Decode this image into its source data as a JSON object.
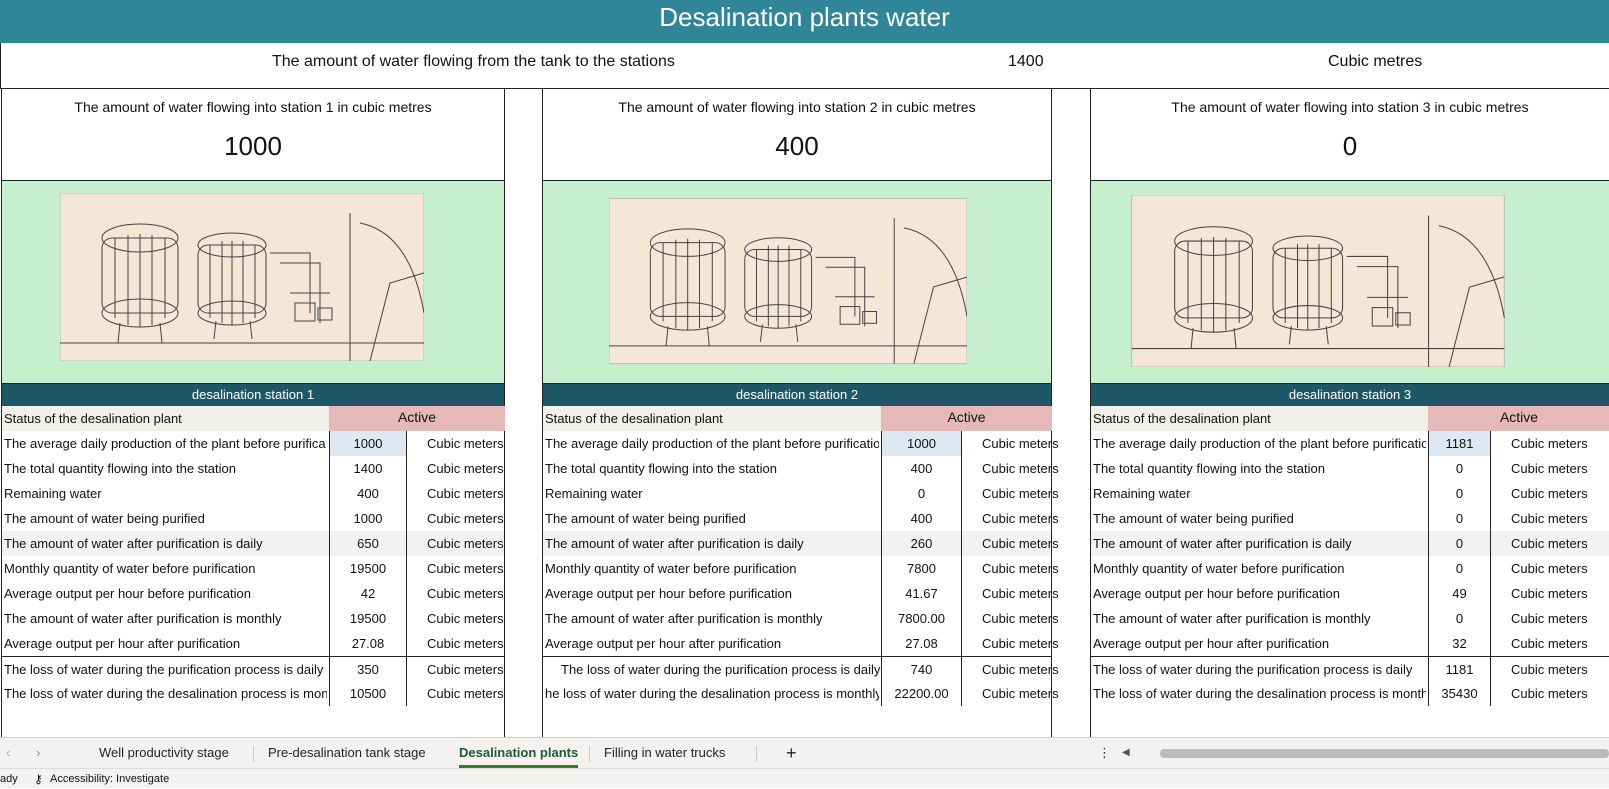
{
  "title": "Desalination plants water",
  "flow": {
    "label": "The amount of water flowing from the tank to the stations",
    "value": "1400",
    "unit": "Cubic metres"
  },
  "stations": [
    {
      "inflow_title": "The amount of water flowing into station 1 in cubic metres",
      "inflow_value": "1000",
      "name": "desalination station 1",
      "status_label": "Status of the desalination plant",
      "status": "Active",
      "rows": [
        {
          "label": "The average daily production of the plant before purifica",
          "value": "1000",
          "unit": "Cubic meters"
        },
        {
          "label": "The total quantity flowing into the station",
          "value": "1400",
          "unit": "Cubic meters"
        },
        {
          "label": "Remaining water",
          "value": "400",
          "unit": "Cubic meters"
        },
        {
          "label": "The amount of water being purified",
          "value": "1000",
          "unit": "Cubic meters"
        },
        {
          "label": "The amount of water after purification is daily",
          "value": "650",
          "unit": "Cubic meters"
        },
        {
          "label": "Monthly quantity of water before purification",
          "value": "19500",
          "unit": "Cubic meters"
        },
        {
          "label": "Average output per hour before purification",
          "value": "42",
          "unit": "Cubic meters"
        },
        {
          "label": "The amount of water after purification is monthly",
          "value": "19500",
          "unit": "Cubic meters"
        },
        {
          "label": "Average output per hour after purification",
          "value": "27.08",
          "unit": "Cubic meters"
        },
        {
          "label": "The loss of water during the purification process is daily",
          "value": "350",
          "unit": "Cubic meters"
        },
        {
          "label": "The loss of water during the desalination process is mont",
          "value": "10500",
          "unit": "Cubic meters"
        }
      ]
    },
    {
      "inflow_title": "The amount of water flowing into station 2 in cubic metres",
      "inflow_value": "400",
      "name": "desalination station 2",
      "status_label": "Status of the desalination plant",
      "status": "Active",
      "rows": [
        {
          "label": "The average daily production of the plant before purificatio",
          "value": "1000",
          "unit": "Cubic meters"
        },
        {
          "label": "The total quantity flowing into the station",
          "value": "400",
          "unit": "Cubic meters"
        },
        {
          "label": "Remaining water",
          "value": "0",
          "unit": "Cubic meters"
        },
        {
          "label": "The amount of water being purified",
          "value": "400",
          "unit": "Cubic meters"
        },
        {
          "label": "The amount of water after purification is daily",
          "value": "260",
          "unit": "Cubic meters"
        },
        {
          "label": "Monthly quantity of water before purification",
          "value": "7800",
          "unit": "Cubic meters"
        },
        {
          "label": "Average output per hour before purification",
          "value": "41.67",
          "unit": "Cubic meters"
        },
        {
          "label": "The amount of water after purification is monthly",
          "value": "7800.00",
          "unit": "Cubic meters"
        },
        {
          "label": "Average output per hour after purification",
          "value": "27.08",
          "unit": "Cubic meters"
        },
        {
          "label": "The loss of water during the purification process is daily",
          "value": "740",
          "unit": "Cubic meters"
        },
        {
          "label": "he loss of water during the desalination process is monthly",
          "value": "22200.00",
          "unit": "Cubic meters"
        }
      ]
    },
    {
      "inflow_title": "The amount of water flowing into station 3 in cubic metres",
      "inflow_value": "0",
      "name": "desalination station 3",
      "status_label": "Status of the desalination plant",
      "status": "Active",
      "rows": [
        {
          "label": "The average daily production of the plant before purificatio",
          "value": "1181",
          "unit": "Cubic meters"
        },
        {
          "label": "The total quantity flowing into the station",
          "value": "0",
          "unit": "Cubic meters"
        },
        {
          "label": "Remaining water",
          "value": "0",
          "unit": "Cubic meters"
        },
        {
          "label": "The amount of water being purified",
          "value": "0",
          "unit": "Cubic meters"
        },
        {
          "label": "The amount of water after purification is daily",
          "value": "0",
          "unit": "Cubic meters"
        },
        {
          "label": "Monthly quantity of water before purification",
          "value": "0",
          "unit": "Cubic meters"
        },
        {
          "label": "Average output per hour before purification",
          "value": "49",
          "unit": "Cubic meters"
        },
        {
          "label": "The amount of water after purification is monthly",
          "value": "0",
          "unit": "Cubic meters"
        },
        {
          "label": "Average output per hour after purification",
          "value": "32",
          "unit": "Cubic meters"
        },
        {
          "label": "The loss of water during the purification process is daily",
          "value": "1181",
          "unit": "Cubic meters"
        },
        {
          "label": "The loss of water during the desalination process is monthl",
          "value": "35430",
          "unit": "Cubic meters"
        }
      ]
    }
  ],
  "sheet_tabs": [
    "Well productivity stage",
    "Pre-desalination tank stage",
    "Desalination plants",
    "Filling in water trucks"
  ],
  "active_tab": "Desalination plants",
  "add_tab": "+",
  "status_bar": {
    "ready": "ady",
    "accessibility": "Accessibility: Investigate"
  }
}
